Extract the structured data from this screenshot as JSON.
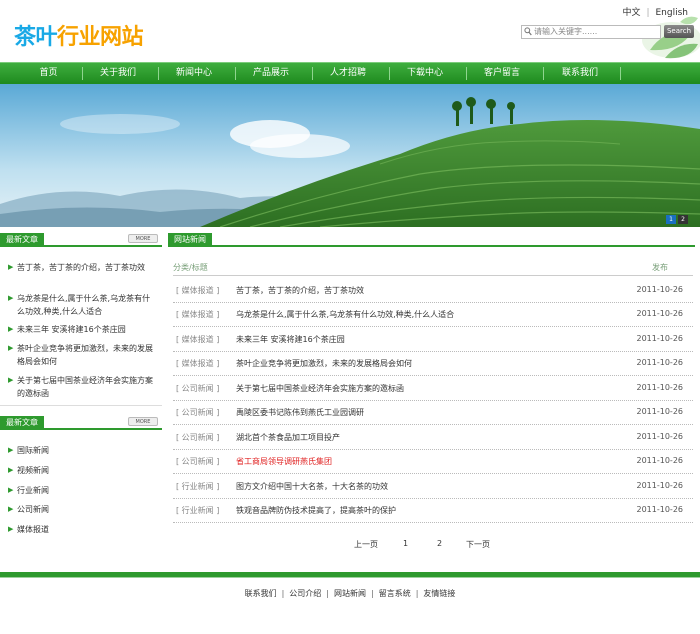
{
  "header": {
    "logo_part1": "茶叶",
    "logo_part2": "行业网站",
    "lang_cn": "中文",
    "lang_sep": "|",
    "lang_en": "English",
    "search_placeholder": "请输入关键字......",
    "search_button": "Search"
  },
  "nav": [
    "首页",
    "关于我们",
    "新闻中心",
    "产品展示",
    "人才招聘",
    "下载中心",
    "客户留言",
    "联系我们"
  ],
  "banner": {
    "dots": [
      "1",
      "2"
    ]
  },
  "sidebar": {
    "box1": {
      "title": "最新文章",
      "more": "MORE",
      "items": [
        "苦丁茶，苦丁茶的介绍，苦丁茶功效",
        "乌龙茶是什么,属于什么茶,乌龙茶有什么功效,种类,什么人适合",
        "未来三年 安溪将建16个茶庄园",
        "茶叶企业竞争将更加激烈，未来的发展格局会如何",
        "关于第七届中国茶业经济年会实施方案的邀标函"
      ]
    },
    "box2": {
      "title": "最新文章",
      "more": "MORE",
      "items": [
        "国际新闻",
        "视频新闻",
        "行业新闻",
        "公司新闻",
        "媒体报道"
      ]
    }
  },
  "main": {
    "title": "网站新闻",
    "col_category": "分类/标题",
    "col_date": "发布",
    "rows": [
      {
        "cat": "[ 媒体报道 ]",
        "title": "苦丁茶，苦丁茶的介绍，苦丁茶功效",
        "date": "2011-10-26",
        "highlight": false
      },
      {
        "cat": "[ 媒体报道 ]",
        "title": "乌龙茶是什么,属于什么茶,乌龙茶有什么功效,种类,什么人适合",
        "date": "2011-10-26",
        "highlight": false
      },
      {
        "cat": "[ 媒体报道 ]",
        "title": "未来三年 安溪将建16个茶庄园",
        "date": "2011-10-26",
        "highlight": false
      },
      {
        "cat": "[ 媒体报道 ]",
        "title": "茶叶企业竞争将更加激烈，未来的发展格局会如何",
        "date": "2011-10-26",
        "highlight": false
      },
      {
        "cat": "[ 公司新闻 ]",
        "title": "关于第七届中国茶业经济年会实施方案的邀标函",
        "date": "2011-10-26",
        "highlight": false
      },
      {
        "cat": "[ 公司新闻 ]",
        "title": "禹陵区委书记陈伟到燕氏工业园调研",
        "date": "2011-10-26",
        "highlight": false
      },
      {
        "cat": "[ 公司新闻 ]",
        "title": "湖北首个茶食品加工项目投产",
        "date": "2011-10-26",
        "highlight": false
      },
      {
        "cat": "[ 公司新闻 ]",
        "title": "省工商局领导调研燕氏集团",
        "date": "2011-10-26",
        "highlight": true
      },
      {
        "cat": "[ 行业新闻 ]",
        "title": "图方文介绍中国十大名茶，十大名茶的功效",
        "date": "2011-10-26",
        "highlight": false
      },
      {
        "cat": "[ 行业新闻 ]",
        "title": "铁观音品牌防伪技术提高了，提高茶叶的保护",
        "date": "2011-10-26",
        "highlight": false
      }
    ],
    "pager": {
      "prev": "上一页",
      "p1": "1",
      "p2": "2",
      "next": "下一页"
    }
  },
  "footer": {
    "links": [
      "联系我们",
      "公司介绍",
      "网站新闻",
      "留言系统",
      "友情链接"
    ],
    "sep": "|"
  },
  "colors": {
    "accent_green": "#2e9a2e",
    "highlight_red": "#e02020",
    "logo_blue": "#19a9e6",
    "logo_orange": "#f7a200"
  }
}
